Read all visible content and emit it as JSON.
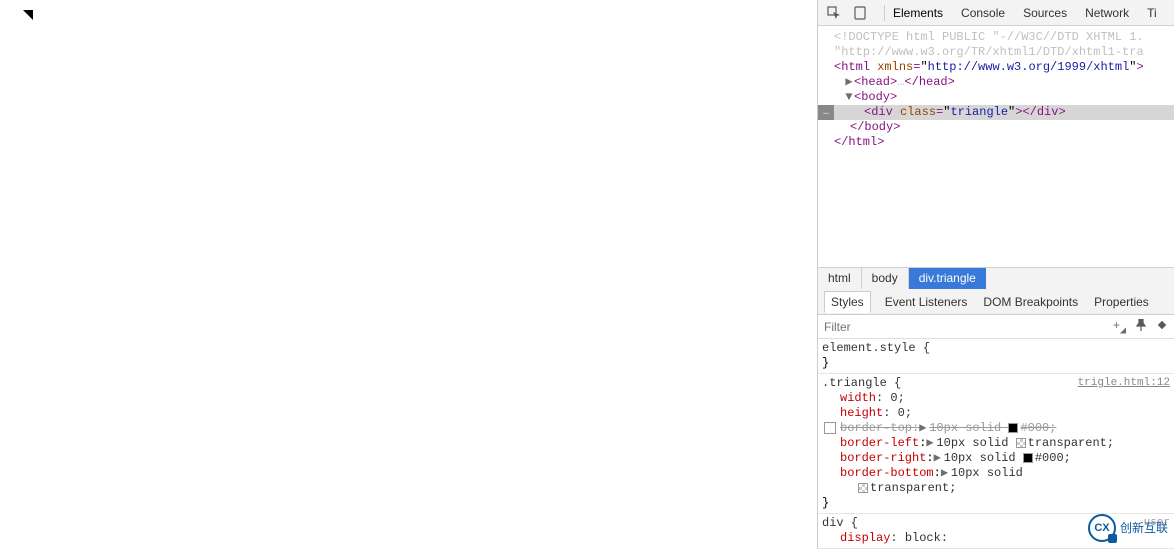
{
  "tabs": {
    "elements": "Elements",
    "console": "Console",
    "sources": "Sources",
    "network": "Network",
    "more": "Ti"
  },
  "dom": {
    "doctype_a": "<!DOCTYPE html PUBLIC \"-//W3C//DTD XHTML 1.",
    "doctype_b": "\"http://www.w3.org/TR/xhtml1/DTD/xhtml1-tra",
    "html_open_a": "<",
    "html_tag": "html",
    "html_attr_name": "xmlns",
    "html_attr_val": "http://www.w3.org/1999/xhtml",
    "html_open_b": ">",
    "head_open": "<head>",
    "head_dots": "…",
    "head_close": "</head>",
    "body_open": "<body>",
    "div_open_a": "<",
    "div_tag": "div",
    "div_attr_name": "class",
    "div_attr_val": "triangle",
    "div_open_b": ">",
    "div_close": "</div>",
    "body_close": "</body>",
    "html_close": "</html>"
  },
  "crumbs": {
    "html": "html",
    "body": "body",
    "div": "div.triangle"
  },
  "styles_tabs": {
    "styles": "Styles",
    "listeners": "Event Listeners",
    "dom_bp": "DOM Breakpoints",
    "props": "Properties"
  },
  "filter": {
    "placeholder": "Filter"
  },
  "element_style": {
    "sel": "element.style {",
    "close": "}"
  },
  "triangle_rule": {
    "sel": ".triangle {",
    "src": "trigle.html:12",
    "width_n": "width",
    "width_v": ": 0;",
    "height_n": "height",
    "height_v": ": 0;",
    "bt_n": "border-top",
    "bt_v": "10px solid ",
    "bt_c": "#000;",
    "bl_n": "border-left",
    "bl_v": "10px solid ",
    "bl_c": "transparent;",
    "br_n": "border-right",
    "br_v": "10px solid ",
    "br_c": "#000;",
    "bb_n": "border-bottom",
    "bb_v": "10px solid",
    "bb_c": "transparent;",
    "close": "}"
  },
  "div_rule": {
    "sel": "div {",
    "ua": "user",
    "disp_n": "display",
    "disp_v": ": block:"
  },
  "watermark": {
    "logo": "CX",
    "text": "创新互联"
  }
}
